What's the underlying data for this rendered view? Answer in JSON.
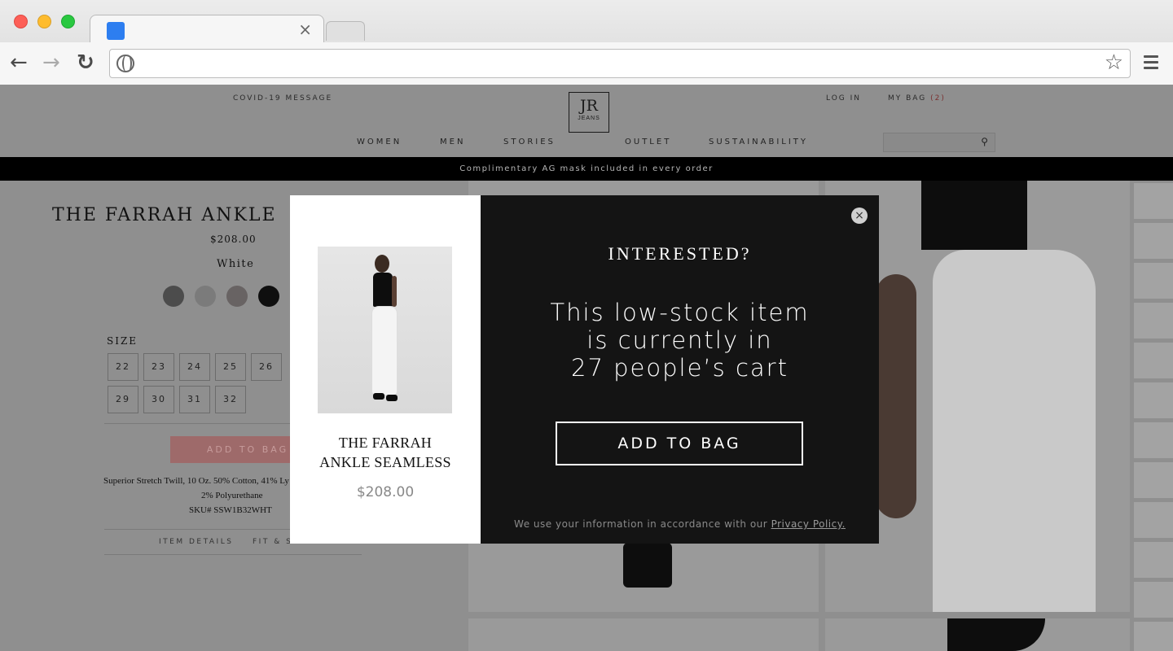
{
  "browser": {
    "tab_close": "×",
    "back_glyph": "←",
    "forward_glyph": "→",
    "reload_glyph": "↻",
    "star_glyph": "☆"
  },
  "header": {
    "covid_link": "COVID-19 MESSAGE",
    "logo_main": "JR",
    "logo_sub": "JEANS",
    "login": "LOG IN",
    "bag_label": "MY BAG",
    "bag_count": "(2)",
    "nav": [
      "WOMEN",
      "MEN",
      "STORIES",
      "OUTLET",
      "SUSTAINABILITY"
    ],
    "search_icon_glyph": "⚲"
  },
  "promo": {
    "text": "Complimentary AG mask included in every order"
  },
  "product": {
    "title": "THE FARRAH ANKLE",
    "price": "$208.00",
    "color": "White",
    "swatch_colors": [
      "#4c4c4c",
      "#7b7b7b",
      "#686363",
      "#0f0f0f"
    ],
    "size_label": "SIZE",
    "sizes_row1": [
      "22",
      "23",
      "24",
      "25",
      "26"
    ],
    "sizes_row2": [
      "29",
      "30",
      "31",
      "32"
    ],
    "add_to_bag": "ADD TO BAG",
    "desc_line1": "Superior Stretch Twill, 10 Oz. 50% Cotton, 41% Ly",
    "desc_line2": "2% Polyurethane",
    "desc_line3": "SKU# SSW1B32WHT",
    "tab_item_details": "ITEM DETAILS",
    "tab_fit": "FIT & SIZE"
  },
  "modal": {
    "product_name_line1": "THE FARRAH",
    "product_name_line2": "ANKLE SEAMLESS",
    "product_price": "$208.00",
    "close_glyph": "×",
    "heading": "INTERESTED?",
    "message_line1": "This low-stock item",
    "message_line2": "is currently in",
    "message_line3": "27 people’s cart",
    "cta": "ADD TO BAG",
    "policy_text": "We use your information in accordance with our",
    "policy_link": "Privacy Policy."
  }
}
